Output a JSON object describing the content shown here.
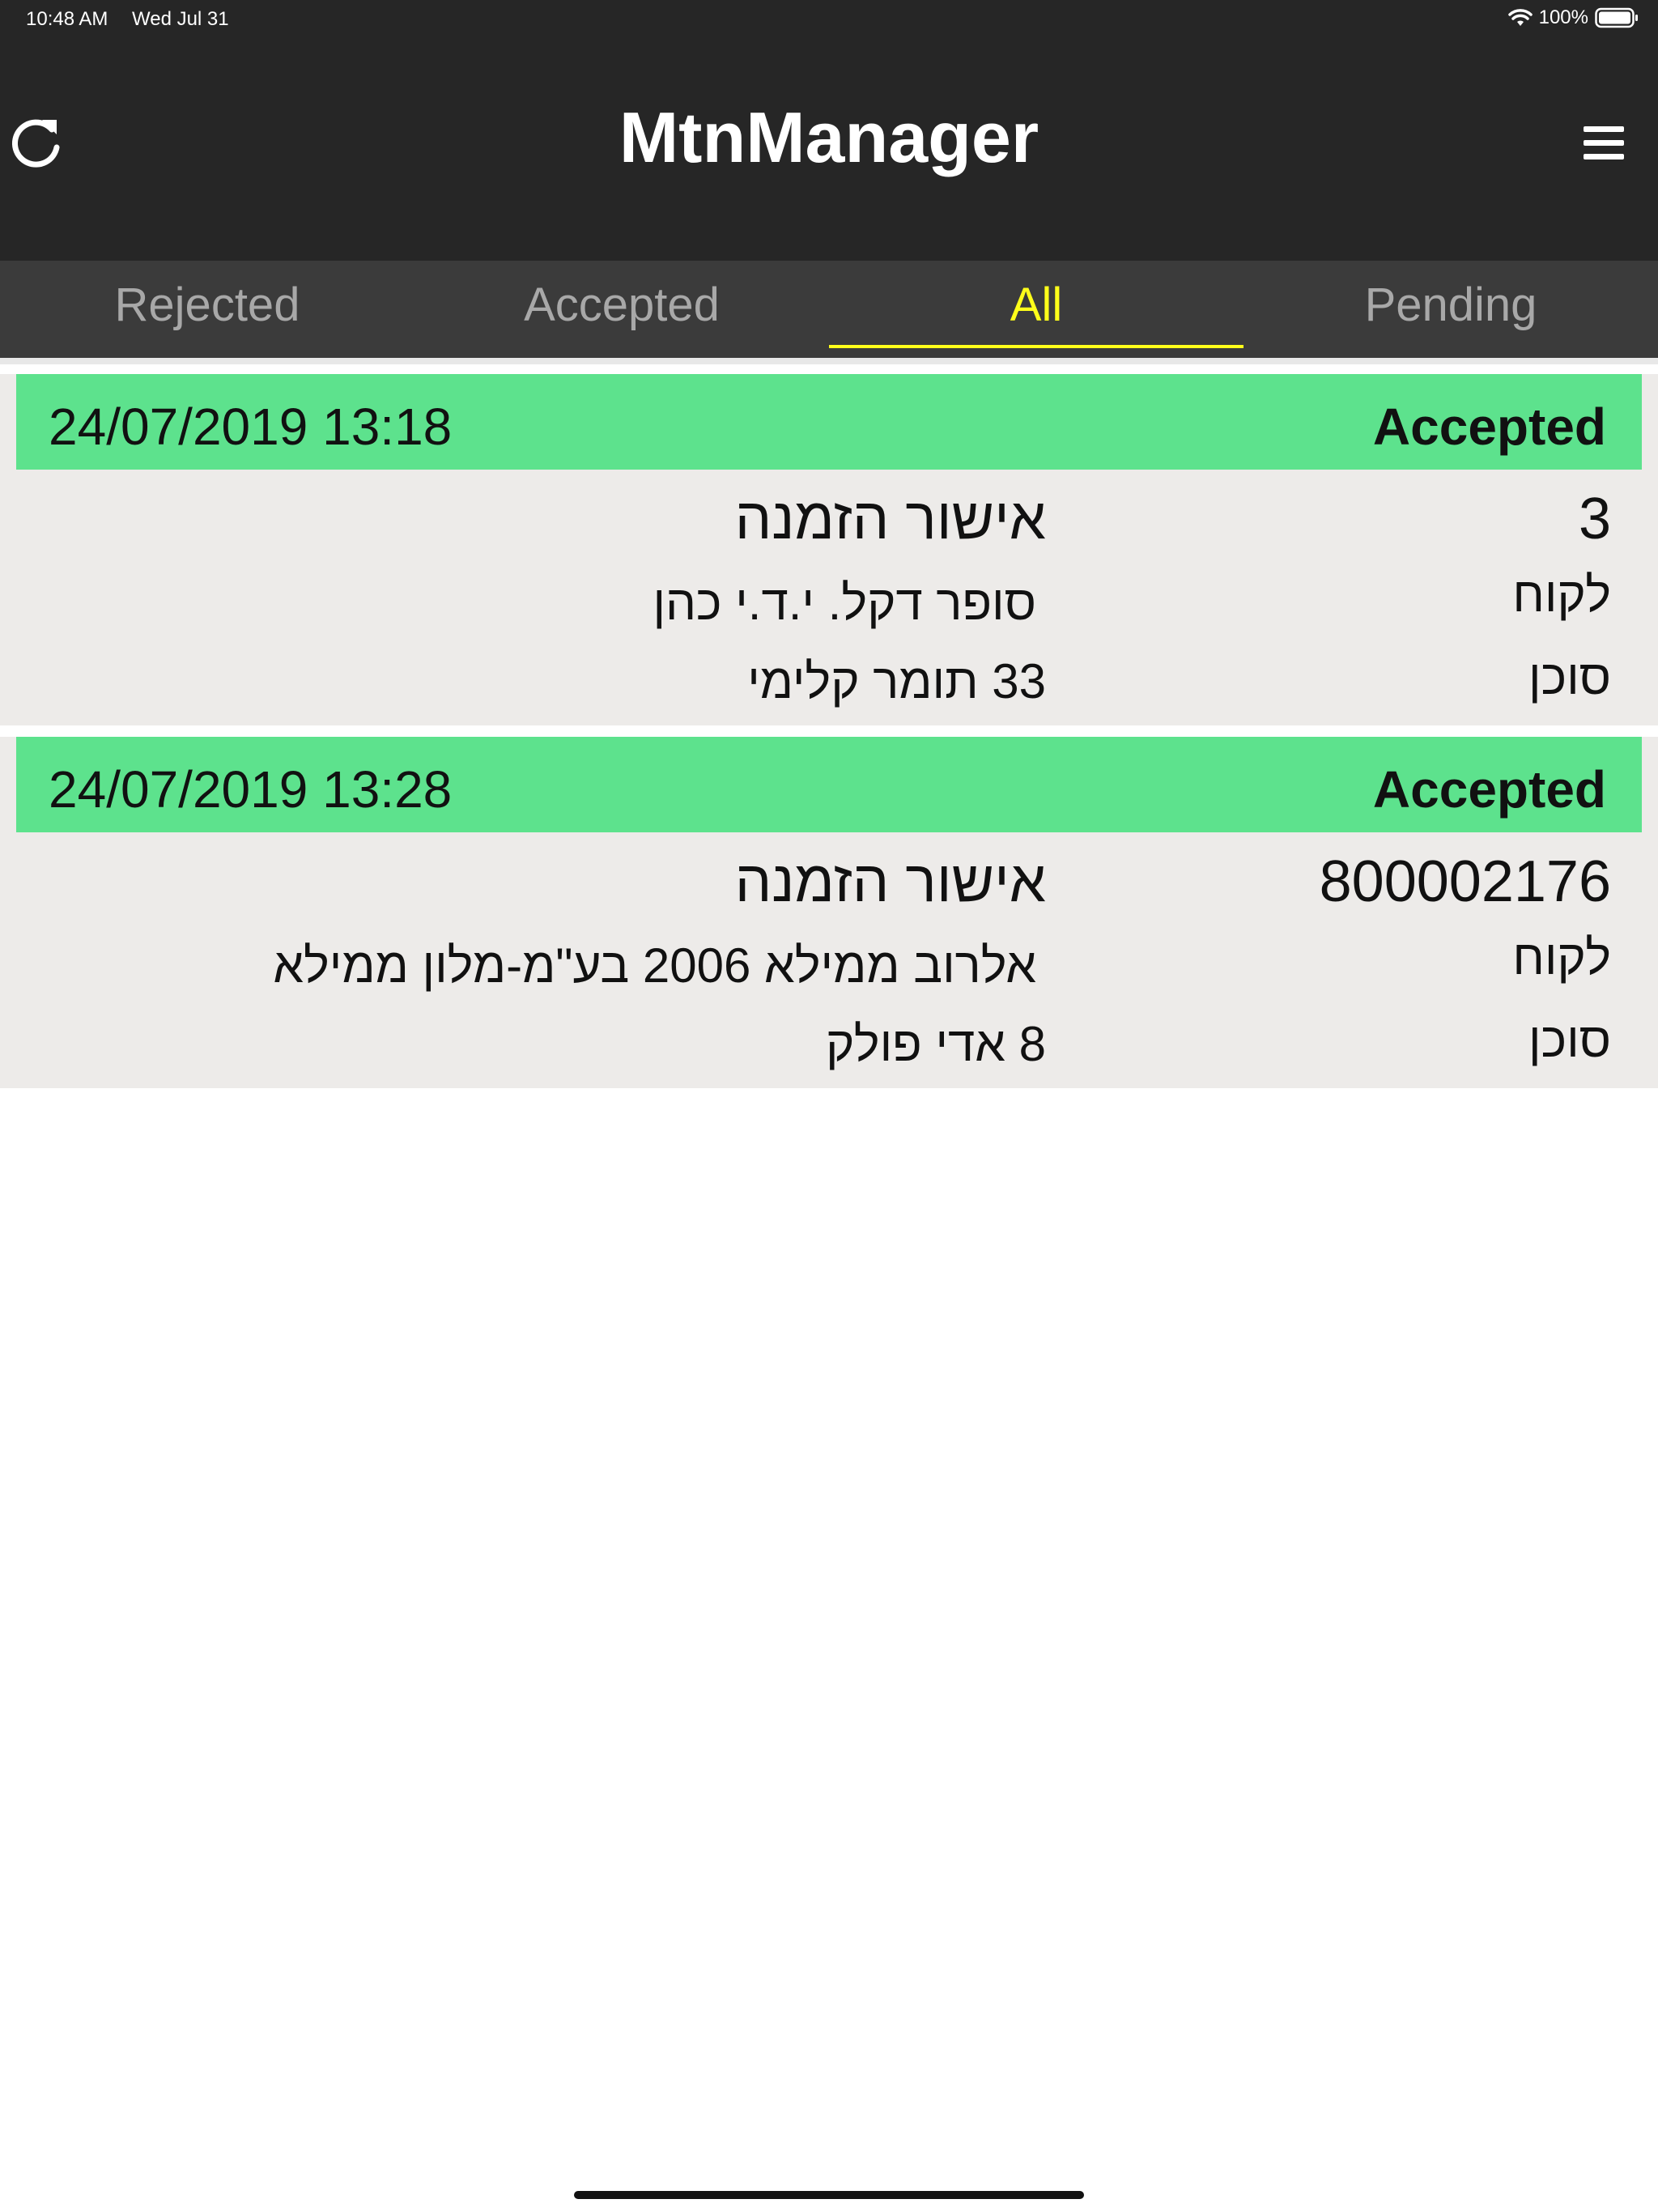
{
  "status_bar": {
    "time": "10:48 AM",
    "date": "Wed Jul 31",
    "battery": "100%"
  },
  "header": {
    "title": "MtnManager",
    "refresh_icon": "refresh-icon",
    "menu_icon": "hamburger-menu-icon"
  },
  "tabs": [
    {
      "label": "Rejected",
      "active": false
    },
    {
      "label": "Accepted",
      "active": false
    },
    {
      "label": "All",
      "active": true
    },
    {
      "label": "Pending",
      "active": false
    }
  ],
  "cards": [
    {
      "date": "24/07/2019 13:18",
      "status": "Accepted",
      "type": "אישור הזמנה",
      "number": "3",
      "customer_label": "לקוח",
      "customer": "סופר דקל. י.ד.י כהן",
      "agent_label": "סוכן",
      "agent": "33 תומר קלימי"
    },
    {
      "date": "24/07/2019 13:28",
      "status": "Accepted",
      "type": "אישור הזמנה",
      "number": "800002176",
      "customer_label": "לקוח",
      "customer": "אלרוב ממילא 2006 בע\"מ-מלון ממילא",
      "agent_label": "סוכן",
      "agent": "8 אדי פולק"
    }
  ],
  "colors": {
    "header_bg": "#262626",
    "tab_bg": "#3b3b3b",
    "tab_active": "#ffff1a",
    "status_green": "#5de28d",
    "card_bg": "#edebe9"
  }
}
